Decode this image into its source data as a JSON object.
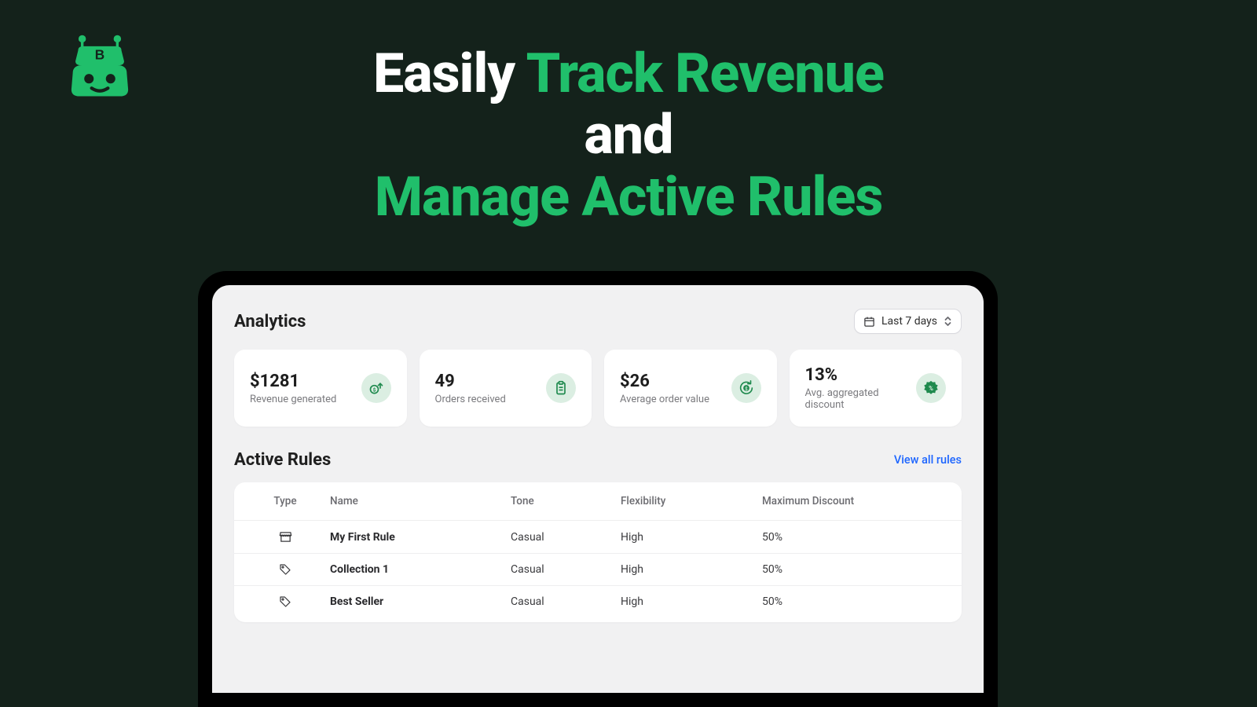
{
  "headline": {
    "p1": "Easily ",
    "p2": "Track Revenue",
    "p3": "and",
    "p4": "Manage Active Rules"
  },
  "analytics": {
    "title": "Analytics",
    "date_range": "Last 7 days",
    "stats": [
      {
        "value": "$1281",
        "label": "Revenue generated"
      },
      {
        "value": "49",
        "label": "Orders received"
      },
      {
        "value": "$26",
        "label": "Average order value"
      },
      {
        "value": "13%",
        "label": "Avg. aggregated discount"
      }
    ]
  },
  "rules": {
    "title": "Active Rules",
    "view_all": "View all rules",
    "headers": {
      "type": "Type",
      "name": "Name",
      "tone": "Tone",
      "flex": "Flexibility",
      "max": "Maximum Discount"
    },
    "rows": [
      {
        "icon": "store",
        "name": "My First Rule",
        "tone": "Casual",
        "flex": "High",
        "max": "50%"
      },
      {
        "icon": "tag",
        "name": "Collection 1",
        "tone": "Casual",
        "flex": "High",
        "max": "50%"
      },
      {
        "icon": "tag",
        "name": "Best Seller",
        "tone": "Casual",
        "flex": "High",
        "max": "50%"
      }
    ]
  }
}
